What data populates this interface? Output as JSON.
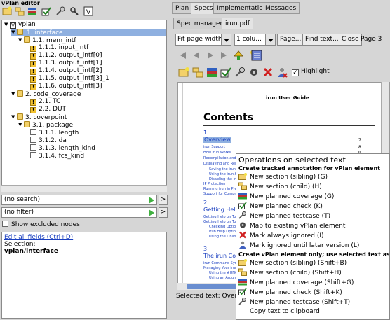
{
  "left": {
    "title": "vPlan editor",
    "toolbar_icons": [
      "new-section-icon",
      "new-child-icon",
      "coverage-icon",
      "check-icon",
      "testcase-icon",
      "link-icon",
      "vplan-icon"
    ],
    "tree": [
      {
        "label": "vplan",
        "badge": "V"
      },
      {
        "label": "1. interface"
      },
      {
        "label": "1.1. mem_intf"
      },
      {
        "label": "1.1.1. input_intf"
      },
      {
        "label": "1.1.2. output_intf[0]"
      },
      {
        "label": "1.1.3. output_intf[1]"
      },
      {
        "label": "1.1.4. output_intf[2]"
      },
      {
        "label": "1.1.5. output_intf[3]_1"
      },
      {
        "label": "1.1.6. output_intf[3]"
      },
      {
        "label": "2. code_coverage"
      },
      {
        "label": "2.1. TC"
      },
      {
        "label": "2.2. DUT"
      },
      {
        "label": "3. coverpoint"
      },
      {
        "label": "3.1. package"
      },
      {
        "label": "3.1.1. length"
      },
      {
        "label": "3.1.2. da"
      },
      {
        "label": "3.1.3. length_kind"
      },
      {
        "label": "3.1.4. fcs_kind"
      }
    ],
    "search_placeholder": "(no search)",
    "filter_placeholder": "(no filter)",
    "go_label": ">",
    "show_excluded": "Show excluded nodes",
    "edit_link": "Edit all fields (Ctrl+D)",
    "selection_label": "Selection:",
    "selection_value": "vplan/interface"
  },
  "right": {
    "tabs": [
      "Plan",
      "Specs",
      "Implementation",
      "Messages"
    ],
    "subtabs": [
      "Spec manager",
      "irun.pdf"
    ],
    "fit": "Fit page width",
    "columns": "1 colu...",
    "page_btn": "Page...",
    "find_btn": "Find text...",
    "close_btn": "Close",
    "page_label": "Page 3",
    "highlight": "Highlight",
    "selected_text": "Selected text: Overvi"
  },
  "pdf": {
    "header": "irun User Guide",
    "contents": "Contents",
    "s1": "1",
    "overview": "Overview",
    "links1": [
      "irun Support",
      "How irun Works",
      "Recompilation and Re",
      "Displaying and Replac",
      "Saving the irun In",
      "Using the irun.hist",
      "Disabling the irun",
      "IP Protection",
      "Running irun in Prep",
      "Support for Compress"
    ],
    "s2": "2",
    "getting_help": "Getting Help o",
    "links2": [
      "Getting Help on Tool",
      "Getting Help on Tool",
      "Checking Options",
      "irun Help Options",
      "Using the Online"
    ],
    "s3": "3",
    "irun_comm": "The irun Comm",
    "links3": [
      "irun Command Syntax",
      "Managing Your irun",
      "Using the #UNOF",
      "Using an Argumen"
    ],
    "page_nums": [
      "7",
      "8",
      "9"
    ]
  },
  "menu": {
    "title": "Operations on selected text",
    "head1": "Create tracked annotation for vPlan element",
    "items1": [
      {
        "label": "New section (sibling) (G)",
        "icon": "new-section-icon"
      },
      {
        "label": "New section (child) (H)",
        "icon": "new-child-section-icon"
      },
      {
        "label": "New planned coverage (G)",
        "icon": "coverage-icon"
      },
      {
        "label": "New planned check (K)",
        "icon": "check-icon"
      },
      {
        "label": "New planned testcase (T)",
        "icon": "testcase-icon"
      },
      {
        "label": "Map to existing vPlan element",
        "icon": "map-icon"
      },
      {
        "label": "Mark always ignored (I)",
        "icon": "ignore-icon"
      },
      {
        "label": "Mark ignored until later version (L)",
        "icon": "ignore-later-icon"
      }
    ],
    "head2": "Create vPlan element only; use selected text as name",
    "items2": [
      {
        "label": "New section (sibling) (Shift+B)",
        "icon": "new-section-icon"
      },
      {
        "label": "New section (child) (Shift+H)",
        "icon": "new-child-section-icon"
      },
      {
        "label": "New planned coverage (Shift+G)",
        "icon": "coverage-icon"
      },
      {
        "label": "New planned check (Shift+K)",
        "icon": "check-icon"
      },
      {
        "label": "New planned testcase (Shift+T)",
        "icon": "testcase-icon"
      },
      {
        "label": "Copy text to clipboard",
        "icon": ""
      }
    ]
  }
}
